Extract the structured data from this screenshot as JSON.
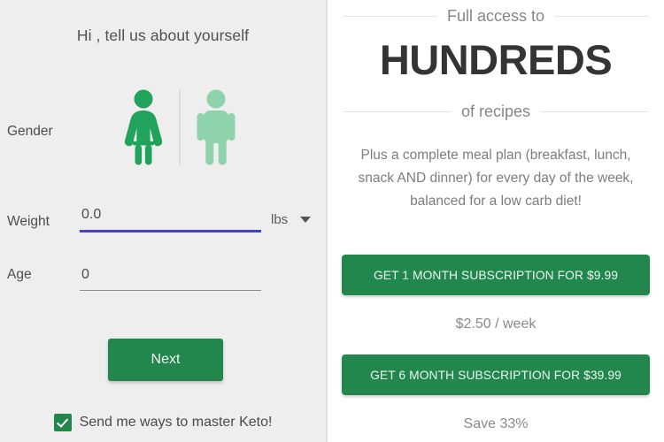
{
  "left": {
    "title": "Hi , tell us about yourself",
    "gender": {
      "label": "Gender",
      "female_option": "female-figure",
      "male_option": "male-figure",
      "selected": "female",
      "selected_color": "#22a35c",
      "unselected_color": "#8ed3ab"
    },
    "weight": {
      "label": "Weight",
      "value": "0.0",
      "placeholder": "0.0",
      "unit": "lbs",
      "underline_color": "#4343c4"
    },
    "age": {
      "label": "Age",
      "value": "0",
      "placeholder": "0"
    },
    "next_button": "Next",
    "newsletter": {
      "label": "Send me ways to master Keto!",
      "checked": true
    },
    "background_color": "#eeeeee"
  },
  "right": {
    "heading_top": "Full access to",
    "heading_hero": "HUNDREDS",
    "heading_bottom": "of recipes",
    "promo_text": "Plus a complete meal plan (breakfast, lunch, snack AND dinner) for every day of the week, balanced for a low carb diet!",
    "offers": [
      {
        "button_label": "GET 1 MONTH SUBSCRIPTION FOR $9.99",
        "note": "$2.50 / week"
      },
      {
        "button_label": "GET 6 MONTH SUBSCRIPTION FOR $39.99",
        "note": "Save 33%"
      }
    ],
    "accent_color": "#22874d",
    "background_color": "#ffffff"
  }
}
